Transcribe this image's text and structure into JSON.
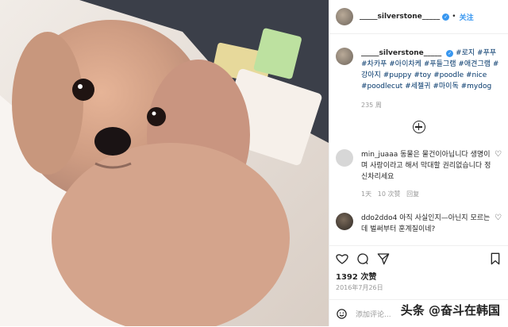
{
  "post": {
    "username": "_____silverstone_____",
    "verified_mark": "✓",
    "follow_separator": "•",
    "follow_label": "关注",
    "caption_tags": [
      "#로지",
      "#푸푸",
      "#차카푸",
      "#아이차케",
      "#푸들그램",
      "#애견그램",
      "#강아지",
      "#puppy",
      "#toy",
      "#poodle",
      "#nice",
      "#poodlecut",
      "#세젤귀",
      "#마이독",
      "#mydog"
    ],
    "caption_time": "235 周",
    "likes": "1392 次赞",
    "date": "2016年7月26日",
    "comment_placeholder": "添加评论...",
    "watermark": "头条 @奋斗在韩国"
  },
  "comments": [
    {
      "username": "min_juaaa",
      "text": "동물은 물건이아닙니다 생명이며 사랑이라고 해서 막대할 권리없습니다 정신차리세요",
      "time": "1天",
      "likes": "10 次赞",
      "reply": "回复"
    },
    {
      "username": "ddo2ddo4",
      "text": "아직 사실인지—아닌지 모르는데 벌써부터 훈계질이네?",
      "time": "",
      "likes": "",
      "reply": ""
    }
  ],
  "icons": {
    "heart": "heart-icon",
    "comment": "comment-icon",
    "share": "share-icon",
    "bookmark": "bookmark-icon",
    "emoji": "emoji-icon",
    "more_comments": "plus-icon"
  },
  "colors": {
    "link_blue": "#3897f0",
    "hashtag": "#003569",
    "meta_gray": "#999999"
  }
}
